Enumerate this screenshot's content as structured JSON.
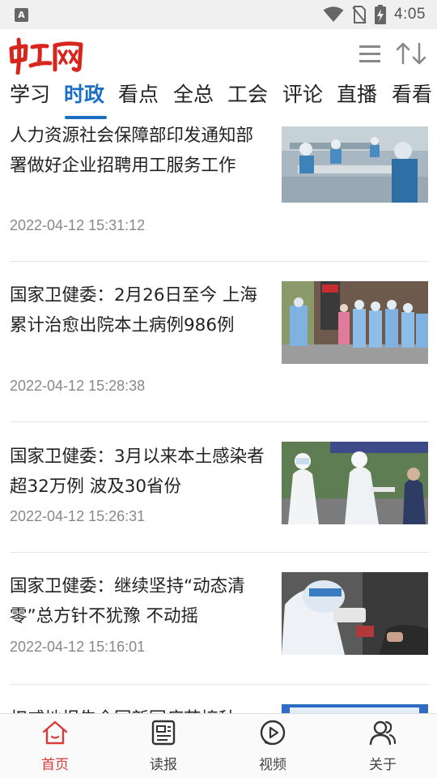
{
  "status_bar": {
    "app_icon_letter": "A",
    "time": "4:05"
  },
  "header": {
    "logo_text": "中工网",
    "colors": {
      "logo": "#d7261e",
      "accent": "#1a6fc4",
      "active_nav": "#d93a3a"
    }
  },
  "tabs": [
    {
      "label": "学习"
    },
    {
      "label": "时政",
      "active": true
    },
    {
      "label": "看点"
    },
    {
      "label": "全总"
    },
    {
      "label": "工会"
    },
    {
      "label": "评论"
    },
    {
      "label": "直播"
    },
    {
      "label": "看看"
    }
  ],
  "feed": [
    {
      "title": "人力资源社会保障部印发通知部署做好企业招聘用工服务工作",
      "time": "2022-04-12 15:31:12"
    },
    {
      "title": "国家卫健委：2月26日至今 上海累计治愈出院本土病例986例",
      "time": "2022-04-12 15:28:38"
    },
    {
      "title": "国家卫健委：3月以来本土感染者超32万例 波及30省份",
      "time": "2022-04-12 15:26:31"
    },
    {
      "title": "国家卫健委：继续坚持“动态清零”总方针不犹豫 不动摇",
      "time": "2022-04-12 15:16:01"
    },
    {
      "title": "权威地报告全国新冠疫苗接种",
      "time": ""
    }
  ],
  "bottom_nav": [
    {
      "label": "首页",
      "icon": "home-icon",
      "active": true
    },
    {
      "label": "读报",
      "icon": "newspaper-icon"
    },
    {
      "label": "视频",
      "icon": "video-play-icon"
    },
    {
      "label": "关于",
      "icon": "users-icon"
    }
  ]
}
